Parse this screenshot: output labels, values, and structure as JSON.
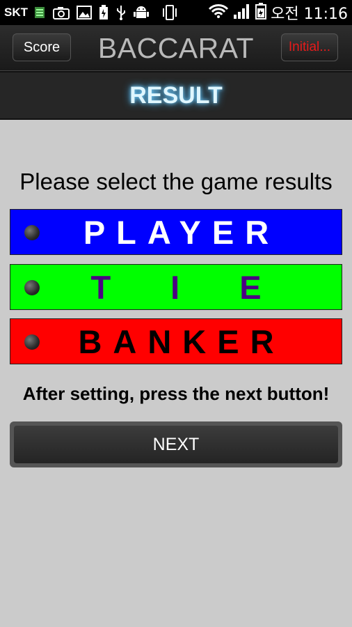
{
  "status_bar": {
    "carrier": "SKT",
    "icons": [
      "sim-icon",
      "camera-icon",
      "gallery-icon",
      "battery-save-icon",
      "usb-icon",
      "android-icon",
      "vibrate-icon",
      "wifi-icon",
      "signal-icon",
      "battery-icon"
    ],
    "clock": "오전 11:16"
  },
  "action_bar": {
    "score_label": "Score",
    "title": "BACCARAT",
    "initial_label": "Initial..."
  },
  "result_header": {
    "title": "RESULT"
  },
  "main": {
    "prompt": "Please select the game results",
    "options": [
      {
        "label": "PLAYER",
        "color": "#0000ff",
        "text_color": "#ffffff"
      },
      {
        "label": "TIE",
        "color": "#00ff00",
        "text_color": "#4b0082"
      },
      {
        "label": "BANKER",
        "color": "#ff0000",
        "text_color": "#000000"
      }
    ],
    "hint": "After setting, press the next button!",
    "next_label": "NEXT"
  },
  "colors": {
    "background": "#cbcbcb",
    "header_glow": "#7cd4ff",
    "initial_text": "#e81a1a"
  }
}
